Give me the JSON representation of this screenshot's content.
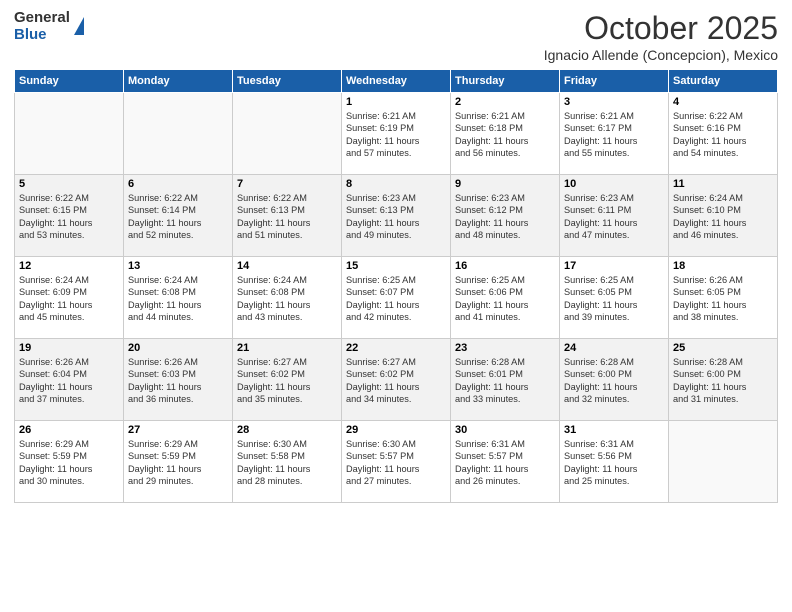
{
  "logo": {
    "general": "General",
    "blue": "Blue"
  },
  "header": {
    "month": "October 2025",
    "location": "Ignacio Allende (Concepcion), Mexico"
  },
  "weekdays": [
    "Sunday",
    "Monday",
    "Tuesday",
    "Wednesday",
    "Thursday",
    "Friday",
    "Saturday"
  ],
  "weeks": [
    [
      {
        "day": "",
        "info": ""
      },
      {
        "day": "",
        "info": ""
      },
      {
        "day": "",
        "info": ""
      },
      {
        "day": "1",
        "info": "Sunrise: 6:21 AM\nSunset: 6:19 PM\nDaylight: 11 hours\nand 57 minutes."
      },
      {
        "day": "2",
        "info": "Sunrise: 6:21 AM\nSunset: 6:18 PM\nDaylight: 11 hours\nand 56 minutes."
      },
      {
        "day": "3",
        "info": "Sunrise: 6:21 AM\nSunset: 6:17 PM\nDaylight: 11 hours\nand 55 minutes."
      },
      {
        "day": "4",
        "info": "Sunrise: 6:22 AM\nSunset: 6:16 PM\nDaylight: 11 hours\nand 54 minutes."
      }
    ],
    [
      {
        "day": "5",
        "info": "Sunrise: 6:22 AM\nSunset: 6:15 PM\nDaylight: 11 hours\nand 53 minutes."
      },
      {
        "day": "6",
        "info": "Sunrise: 6:22 AM\nSunset: 6:14 PM\nDaylight: 11 hours\nand 52 minutes."
      },
      {
        "day": "7",
        "info": "Sunrise: 6:22 AM\nSunset: 6:13 PM\nDaylight: 11 hours\nand 51 minutes."
      },
      {
        "day": "8",
        "info": "Sunrise: 6:23 AM\nSunset: 6:13 PM\nDaylight: 11 hours\nand 49 minutes."
      },
      {
        "day": "9",
        "info": "Sunrise: 6:23 AM\nSunset: 6:12 PM\nDaylight: 11 hours\nand 48 minutes."
      },
      {
        "day": "10",
        "info": "Sunrise: 6:23 AM\nSunset: 6:11 PM\nDaylight: 11 hours\nand 47 minutes."
      },
      {
        "day": "11",
        "info": "Sunrise: 6:24 AM\nSunset: 6:10 PM\nDaylight: 11 hours\nand 46 minutes."
      }
    ],
    [
      {
        "day": "12",
        "info": "Sunrise: 6:24 AM\nSunset: 6:09 PM\nDaylight: 11 hours\nand 45 minutes."
      },
      {
        "day": "13",
        "info": "Sunrise: 6:24 AM\nSunset: 6:08 PM\nDaylight: 11 hours\nand 44 minutes."
      },
      {
        "day": "14",
        "info": "Sunrise: 6:24 AM\nSunset: 6:08 PM\nDaylight: 11 hours\nand 43 minutes."
      },
      {
        "day": "15",
        "info": "Sunrise: 6:25 AM\nSunset: 6:07 PM\nDaylight: 11 hours\nand 42 minutes."
      },
      {
        "day": "16",
        "info": "Sunrise: 6:25 AM\nSunset: 6:06 PM\nDaylight: 11 hours\nand 41 minutes."
      },
      {
        "day": "17",
        "info": "Sunrise: 6:25 AM\nSunset: 6:05 PM\nDaylight: 11 hours\nand 39 minutes."
      },
      {
        "day": "18",
        "info": "Sunrise: 6:26 AM\nSunset: 6:05 PM\nDaylight: 11 hours\nand 38 minutes."
      }
    ],
    [
      {
        "day": "19",
        "info": "Sunrise: 6:26 AM\nSunset: 6:04 PM\nDaylight: 11 hours\nand 37 minutes."
      },
      {
        "day": "20",
        "info": "Sunrise: 6:26 AM\nSunset: 6:03 PM\nDaylight: 11 hours\nand 36 minutes."
      },
      {
        "day": "21",
        "info": "Sunrise: 6:27 AM\nSunset: 6:02 PM\nDaylight: 11 hours\nand 35 minutes."
      },
      {
        "day": "22",
        "info": "Sunrise: 6:27 AM\nSunset: 6:02 PM\nDaylight: 11 hours\nand 34 minutes."
      },
      {
        "day": "23",
        "info": "Sunrise: 6:28 AM\nSunset: 6:01 PM\nDaylight: 11 hours\nand 33 minutes."
      },
      {
        "day": "24",
        "info": "Sunrise: 6:28 AM\nSunset: 6:00 PM\nDaylight: 11 hours\nand 32 minutes."
      },
      {
        "day": "25",
        "info": "Sunrise: 6:28 AM\nSunset: 6:00 PM\nDaylight: 11 hours\nand 31 minutes."
      }
    ],
    [
      {
        "day": "26",
        "info": "Sunrise: 6:29 AM\nSunset: 5:59 PM\nDaylight: 11 hours\nand 30 minutes."
      },
      {
        "day": "27",
        "info": "Sunrise: 6:29 AM\nSunset: 5:59 PM\nDaylight: 11 hours\nand 29 minutes."
      },
      {
        "day": "28",
        "info": "Sunrise: 6:30 AM\nSunset: 5:58 PM\nDaylight: 11 hours\nand 28 minutes."
      },
      {
        "day": "29",
        "info": "Sunrise: 6:30 AM\nSunset: 5:57 PM\nDaylight: 11 hours\nand 27 minutes."
      },
      {
        "day": "30",
        "info": "Sunrise: 6:31 AM\nSunset: 5:57 PM\nDaylight: 11 hours\nand 26 minutes."
      },
      {
        "day": "31",
        "info": "Sunrise: 6:31 AM\nSunset: 5:56 PM\nDaylight: 11 hours\nand 25 minutes."
      },
      {
        "day": "",
        "info": ""
      }
    ]
  ]
}
